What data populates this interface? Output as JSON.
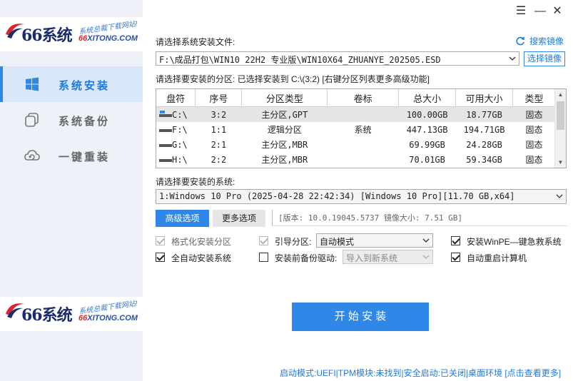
{
  "sidebar": {
    "logo": {
      "brand": "66系统",
      "slogan": "系统总裁下载网站!",
      "domain_prefix": "66",
      "domain_rest": "XITONG.COM"
    },
    "items": [
      {
        "label": "系统安装",
        "icon": "windows-icon",
        "active": true
      },
      {
        "label": "系统备份",
        "icon": "copy-icon",
        "active": false
      },
      {
        "label": "一键重装",
        "icon": "cloud-refresh-icon",
        "active": false
      }
    ]
  },
  "window": {
    "menu_icon": "☰",
    "minimize": "—",
    "close": "✕"
  },
  "install_file": {
    "label": "请选择系统安装文件:",
    "search_label": "搜索镜像",
    "path": "F:\\成品打包\\WIN10 22H2 专业版\\WIN10X64_ZHUANYE_202505.ESD",
    "choose_button": "选择镜像"
  },
  "partition": {
    "label": "请选择要安装的分区: 已选择安装到 C:\\(3:2) [右键分区列表更多高级功能]",
    "columns": [
      "盘符",
      "序号",
      "分区类型",
      "卷标",
      "总大小",
      "可用大小",
      "类型"
    ],
    "rows": [
      {
        "drive": "C:\\",
        "index": "3:2",
        "ptype": "主分区,GPT",
        "label": "",
        "total": "100.00GB",
        "free": "18.77GB",
        "kind": "固态",
        "selected": true
      },
      {
        "drive": "F:\\",
        "index": "1:1",
        "ptype": "逻辑分区",
        "label": "系统",
        "total": "447.13GB",
        "free": "194.71GB",
        "kind": "固态",
        "selected": false
      },
      {
        "drive": "G:\\",
        "index": "2:1",
        "ptype": "主分区,MBR",
        "label": "",
        "total": "69.99GB",
        "free": "24.28GB",
        "kind": "固态",
        "selected": false
      },
      {
        "drive": "H:\\",
        "index": "2:2",
        "ptype": "主分区,MBR",
        "label": "",
        "total": "70.01GB",
        "free": "59.34GB",
        "kind": "固态",
        "selected": false
      }
    ]
  },
  "system": {
    "label": "请选择要安装的系统:",
    "value": "1:Windows 10 Pro (2025-04-28 22:42:34) [Windows 10 Pro][11.70 GB,x64]"
  },
  "tabs": {
    "advanced": "高级选项",
    "more": "更多选项"
  },
  "version_info": "[版本: 10.0.19045.5737 镜像大小: 7.51 GB]",
  "options": {
    "format": {
      "label": "格式化安装分区",
      "checked": true,
      "disabled": true
    },
    "auto": {
      "label": "全自动安装系统",
      "checked": true,
      "disabled": false
    },
    "boot_label": "引导分区:",
    "boot_checked": true,
    "boot_value": "自动模式",
    "backup_driver": {
      "label": "安装前备份驱动:",
      "checked": false
    },
    "driver_value": "导入到新系统",
    "winpe": {
      "label": "安装WinPE—键急救系统",
      "checked": true
    },
    "reboot": {
      "label": "自动重启计算机",
      "checked": true
    }
  },
  "start_button": "开 始 安 装",
  "status": "启动模式:UEFI|TPM模块:未找到|安全启动:已关闭|桌面环境 [点击查看更多]",
  "colors": {
    "accent": "#2f88e8",
    "sidebar_bg": "#eef2f8",
    "active_bg": "#d9e7fa"
  }
}
